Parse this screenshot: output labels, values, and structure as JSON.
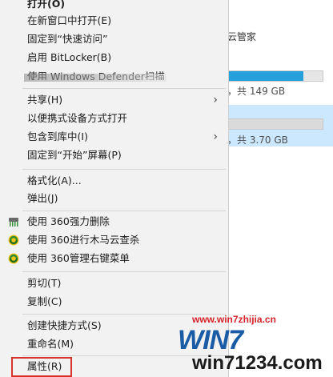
{
  "background": {
    "top_text": "云管家",
    "drive1_size": "，共 149 GB",
    "drive1_fill": 0.8,
    "drive2_size": "，共 3.70 GB",
    "drive2_fill": 0.0,
    "accent": "#26a0da",
    "selected_bg": "#cce8ff"
  },
  "menu": {
    "open": "打开(O)",
    "open_new_window": "在新窗口中打开(E)",
    "pin_quick_access": "固定到“快速访问”",
    "bitlocker": "启用 BitLocker(B)",
    "defender": "使用 Windows Defender扫描",
    "share": "共享(H)",
    "open_portable": "以便携式设备方式打开",
    "include_library": "包含到库中(I)",
    "pin_start": "固定到“开始”屏幕(P)",
    "format": "格式化(A)...",
    "eject": "弹出(J)",
    "force_delete_360": "使用 360强力删除",
    "trojan_scan_360": "使用 360进行木马云查杀",
    "manage_menu_360": "使用 360管理右键菜单",
    "cut": "剪切(T)",
    "copy": "复制(C)",
    "create_shortcut": "创建快捷方式(S)",
    "rename": "重命名(M)",
    "properties": "属性(R)",
    "highlight_color": "#d9342b"
  },
  "watermark": {
    "url": "www.win7zhijia.cn",
    "brand": "WIN7",
    "site": "win71234.com"
  }
}
